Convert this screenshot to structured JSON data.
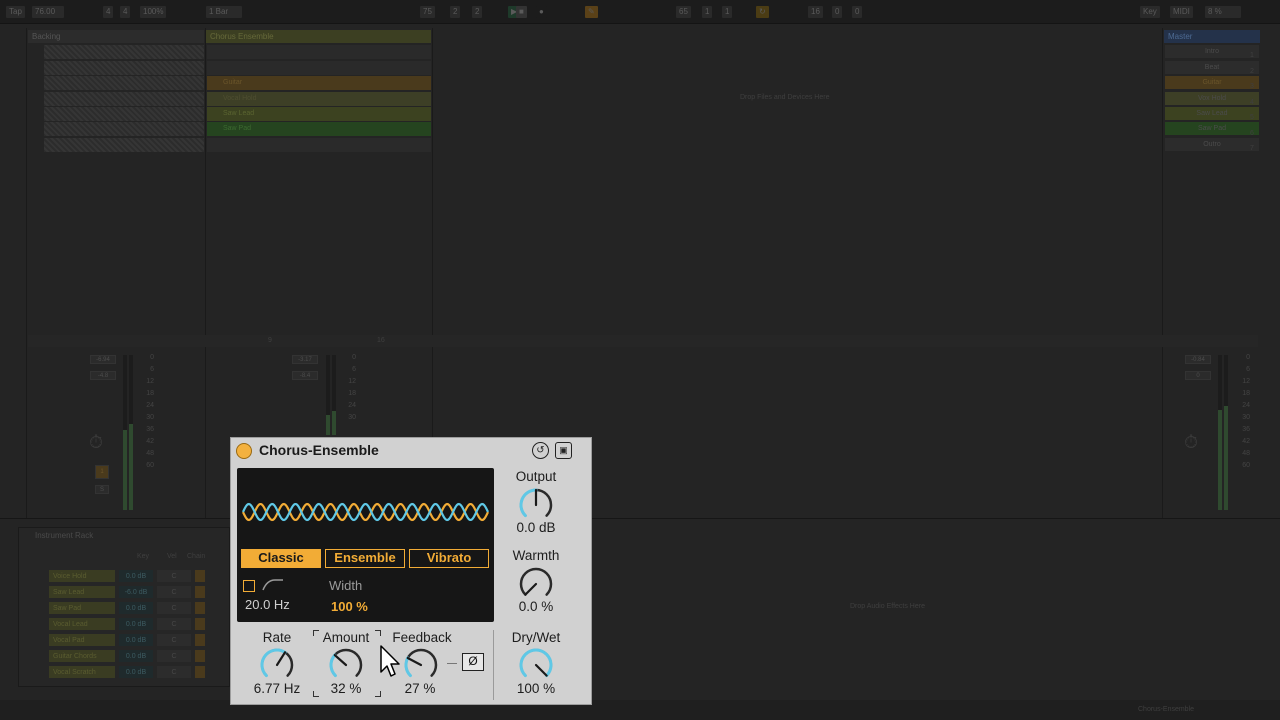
{
  "topbar": {
    "tap": "Tap",
    "tempo": "76.00",
    "sig_num": "4",
    "sig_den": "4",
    "zoom": "100%",
    "quant": "1 Bar",
    "pos_bar": "75",
    "pos_beat": "2",
    "pos_sub": "2",
    "loop_bar": "65",
    "loop_beat": "1",
    "loop_sub": "1",
    "len_bar": "16",
    "len_beat": "0",
    "len_sub": "0",
    "key": "Key",
    "midi": "MIDI",
    "cpu": "8 %"
  },
  "tracks": {
    "backing": {
      "title": "Backing"
    },
    "chorus": {
      "title": "Chorus Ensemble",
      "clips": [
        "",
        "",
        "Guitar",
        "Vocal Hold",
        "Saw Lead",
        "Saw Pad",
        ""
      ]
    },
    "drop_files": "Drop Files and Devices Here",
    "master": {
      "title": "Master",
      "scenes": [
        "Intro",
        "Beat",
        "Guitar",
        "Vox Hold",
        "Saw Lead",
        "Saw Pad",
        "Outro"
      ],
      "numbers": [
        "1",
        "2",
        "3",
        "4",
        "5",
        "6",
        "7"
      ]
    },
    "scale": [
      "0",
      "6",
      "12",
      "18",
      "24",
      "30",
      "36",
      "42",
      "48",
      "60"
    ],
    "backing_vol": "-6.94",
    "backing_pan": "-4.8",
    "chorus_vol": "-3.17",
    "chorus_pan": "-8.4",
    "master_vol": "-0.84",
    "master_pan": "0",
    "track_num": "1",
    "track_s": "S",
    "footer_a": "9",
    "footer_b": "16"
  },
  "rack": {
    "title": "Instrument Rack",
    "headers": [
      "Key",
      "Vel",
      "Chain"
    ],
    "rows": [
      {
        "name": "Voice Hold",
        "val": "0.0 dB",
        "c": "C"
      },
      {
        "name": "Saw Lead",
        "val": "-6.0 dB",
        "c": "C"
      },
      {
        "name": "Saw Pad",
        "val": "0.0 dB",
        "c": "C"
      },
      {
        "name": "Vocal Lead",
        "val": "0.0 dB",
        "c": "C"
      },
      {
        "name": "Vocal Pad",
        "val": "0.0 dB",
        "c": "C"
      },
      {
        "name": "Guitar Chords",
        "val": "0.0 dB",
        "c": "C"
      },
      {
        "name": "Vocal Scratch",
        "val": "0.0 dB",
        "c": "C"
      }
    ],
    "drop_effects": "Drop Audio Effects Here",
    "status": "Chorus-Ensemble"
  },
  "plugin": {
    "title": "Chorus-Ensemble",
    "modes": [
      "Classic",
      "Ensemble",
      "Vibrato"
    ],
    "active_mode": "Classic",
    "freq": "20.0 Hz",
    "width_label": "Width",
    "width_value": "100 %",
    "output_label": "Output",
    "output_value": "0.0 dB",
    "warmth_label": "Warmth",
    "warmth_value": "0.0 %",
    "rate_label": "Rate",
    "rate_value": "6.77 Hz",
    "amount_label": "Amount",
    "amount_value": "32 %",
    "feedback_label": "Feedback",
    "feedback_value": "27 %",
    "invert_label": "Ø",
    "drywet_label": "Dry/Wet",
    "drywet_value": "100 %",
    "knob_levels": {
      "output": 0.5,
      "warmth": 0.0,
      "rate": 0.62,
      "amount": 0.32,
      "feedback": 0.27,
      "drywet": 1.0
    },
    "accent": "#f2ac36",
    "wave_colors": [
      "#f2ac36",
      "#5fc8e6"
    ]
  }
}
